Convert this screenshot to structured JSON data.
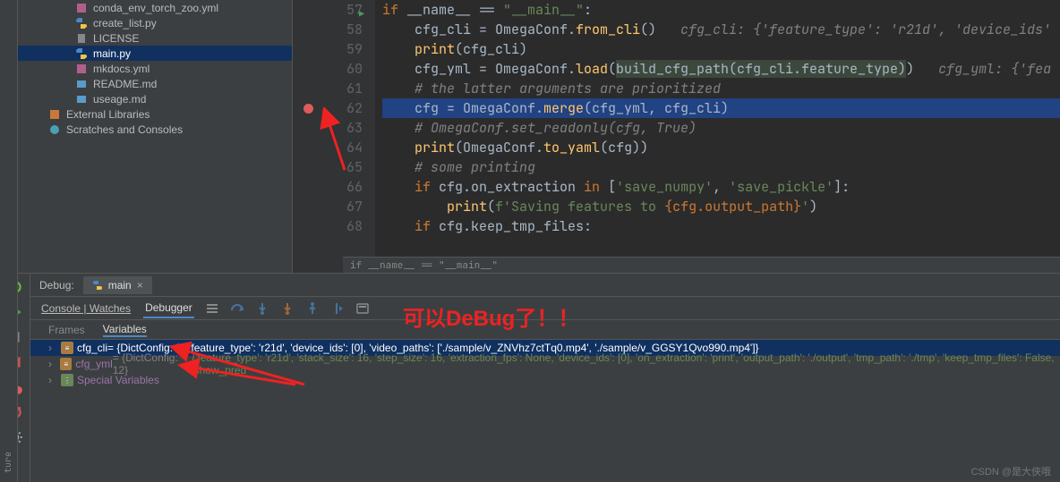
{
  "tree": {
    "items": [
      {
        "icon": "yml",
        "label": "conda_env_torch_zoo.yml",
        "sel": false
      },
      {
        "icon": "py",
        "label": "create_list.py",
        "sel": false
      },
      {
        "icon": "txt",
        "label": "LICENSE",
        "sel": false
      },
      {
        "icon": "py",
        "label": "main.py",
        "sel": true
      },
      {
        "icon": "yml",
        "label": "mkdocs.yml",
        "sel": false
      },
      {
        "icon": "md",
        "label": "README.md",
        "sel": false
      },
      {
        "icon": "md",
        "label": "useage.md",
        "sel": false
      }
    ],
    "ext_label": "External Libraries",
    "scratch_label": "Scratches and Consoles"
  },
  "code": {
    "lines": [
      {
        "n": 57,
        "run": true
      },
      {
        "n": 58
      },
      {
        "n": 59
      },
      {
        "n": 60
      },
      {
        "n": 61
      },
      {
        "n": 62,
        "bp": true,
        "hl": true
      },
      {
        "n": 63
      },
      {
        "n": 64
      },
      {
        "n": 65
      },
      {
        "n": 66
      },
      {
        "n": 67
      },
      {
        "n": 68
      }
    ],
    "l57_a": "if",
    "l57_b": " __name__ == ",
    "l57_c": "\"__main__\"",
    "l57_d": ":",
    "l58_a": "    cfg_cli = OmegaConf.",
    "l58_b": "from_cli",
    "l58_c": "()   ",
    "l58_cm": "cfg_cli: {'feature_type': 'r21d', 'device_ids'",
    "l59_a": "    ",
    "l59_b": "print",
    "l59_c": "(cfg_cli)",
    "l60_a": "    cfg_yml = OmegaConf.",
    "l60_b": "load",
    "l60_c": "(",
    "l60_d": "build_cfg_path(cfg_cli.feature_type)",
    "l60_e": ")   ",
    "l60_cm": "cfg_yml: {'fea",
    "l61": "    # the latter arguments are prioritized",
    "l62_a": "    cfg = OmegaConf.",
    "l62_b": "merge",
    "l62_c": "(cfg_yml, cfg_cli)",
    "l63": "    # OmegaConf.set_readonly(cfg, True)",
    "l64_a": "    ",
    "l64_b": "print",
    "l64_c": "(OmegaConf.",
    "l64_d": "to_yaml",
    "l64_e": "(cfg))",
    "l65": "    # some printing",
    "l66_a": "    ",
    "l66_b": "if",
    "l66_c": " cfg.on_extraction ",
    "l66_d": "in",
    "l66_e": " [",
    "l66_f": "'save_numpy'",
    "l66_g": ", ",
    "l66_h": "'save_pickle'",
    "l66_i": "]:",
    "l67_a": "        ",
    "l67_b": "print",
    "l67_c": "(",
    "l67_d": "f'Saving features to ",
    "l67_e": "{cfg.output_path}",
    "l67_f": "'",
    "l67_g": ")",
    "l68_a": "    ",
    "l68_b": "if",
    "l68_c": " cfg.keep_tmp_files:",
    "breadcrumb": "if __name__ == \"__main__\""
  },
  "debug": {
    "title": "Debug:",
    "tab": "main",
    "tabs": {
      "console": "Console | Watches",
      "debugger": "Debugger"
    },
    "subtabs": {
      "frames": "Frames",
      "vars": "Variables"
    },
    "vars": [
      {
        "name": "cfg_cli",
        "type": " = {DictConfig: 3} ",
        "val": "{'feature_type': 'r21d', 'device_ids': [0], 'video_paths': ['./sample/v_ZNVhz7ctTq0.mp4', './sample/v_GGSY1Qvo990.mp4']}",
        "sel": true
      },
      {
        "name": "cfg_yml",
        "type": " = {DictConfig: 12} ",
        "val": "{'feature_type': 'r21d', 'stack_size': 16, 'step_size': 16, 'extraction_fps': None, 'device_ids': [0], 'on_extraction': 'print', 'output_path': './output', 'tmp_path': './tmp', 'keep_tmp_files': False, 'show_pred",
        "sel": false
      },
      {
        "name": "Special Variables",
        "type": "",
        "val": "",
        "sel": false,
        "special": true
      }
    ]
  },
  "annotation": {
    "text": "可以DeBug了！！"
  },
  "watermark": "CSDN @是大侠哦",
  "verttext": "ture"
}
